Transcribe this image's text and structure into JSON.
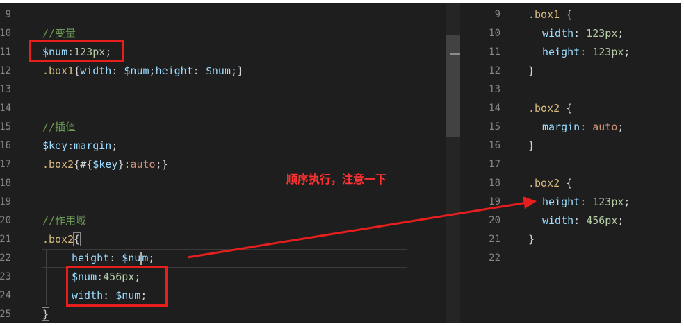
{
  "left_editor": {
    "line_numbers": [
      "9",
      "10",
      "11",
      "12",
      "13",
      "14",
      "15",
      "16",
      "17",
      "18",
      "19",
      "20",
      "21",
      "22",
      "23",
      "24",
      "25"
    ],
    "comment_vars": "//变量",
    "num_decl_var": "$num",
    "num_decl_colon": ":",
    "num_decl_value": "123px",
    "num_decl_semi": ";",
    "box1_sel": ".box1",
    "box1_open": "{",
    "box1_width_prop": "width",
    "box1_colon1": ": ",
    "box1_width_val": "$num",
    "box1_semi1": ";",
    "box1_height_prop": "height",
    "box1_colon2": ": ",
    "box1_height_val": "$num",
    "box1_semi2": ";",
    "box1_close": "}",
    "comment_interp": "//插值",
    "key_var": "$key",
    "key_colon": ":",
    "key_value": "margin",
    "key_semi": ";",
    "box2a_sel": ".box2",
    "box2a_open": "{",
    "interp_open": "#{",
    "interp_var": "$key",
    "interp_close": "}",
    "box2a_colon": ":",
    "box2a_val": "auto",
    "box2a_semi": ";",
    "box2a_close": "}",
    "comment_scope": "//作用域",
    "box2b_sel": ".box2",
    "box2b_open": "{",
    "h_prop": "height",
    "h_colon": ": ",
    "h_val_a": "$nu",
    "h_val_b": "m",
    "h_semi": ";",
    "n2_var": "$num",
    "n2_colon": ":",
    "n2_val": "456px",
    "n2_semi": ";",
    "w_prop": "width",
    "w_colon": ": ",
    "w_val": "$num",
    "w_semi": ";",
    "box2b_close": "}"
  },
  "right_editor": {
    "line_numbers": [
      "9",
      "10",
      "11",
      "12",
      "13",
      "14",
      "15",
      "16",
      "17",
      "18",
      "19",
      "20",
      "21",
      "22"
    ],
    "r9_sel": ".box1",
    "r9_open": " {",
    "r10_prop": "width",
    "r10_colon": ": ",
    "r10_val": "123px",
    "r10_semi": ";",
    "r11_prop": "height",
    "r11_colon": ": ",
    "r11_val": "123px",
    "r11_semi": ";",
    "r12_close": "}",
    "r14_sel": ".box2",
    "r14_open": " {",
    "r15_prop": "margin",
    "r15_colon": ": ",
    "r15_val": "auto",
    "r15_semi": ";",
    "r16_close": "}",
    "r18_sel": ".box2",
    "r18_open": " {",
    "r19_prop": "height",
    "r19_colon": ": ",
    "r19_val": "123px",
    "r19_semi": ";",
    "r20_prop": "width",
    "r20_colon": ": ",
    "r20_val": "456px",
    "r20_semi": ";",
    "r21_close": "}"
  },
  "annotation": {
    "text": "顺序执行，注意一下",
    "color": "#e61e1e"
  },
  "colors": {
    "editor_bg": "#1e1e1e",
    "comment": "#6a9955",
    "variable": "#9cdcfe",
    "number": "#b5cea8",
    "selector": "#d7ba7d",
    "string_value": "#ce9178"
  }
}
